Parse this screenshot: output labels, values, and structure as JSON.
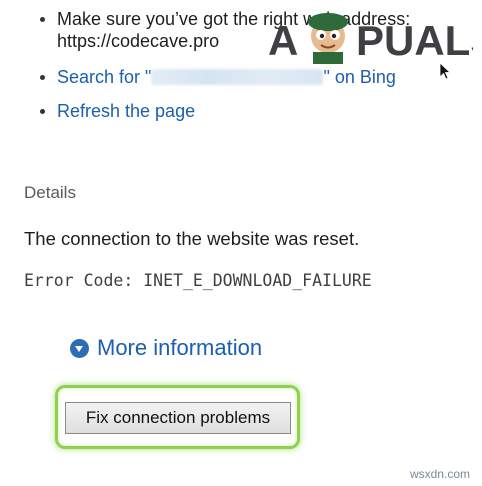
{
  "suggestions": {
    "item1_line1": "Make sure you’ve got the right web address:",
    "item1_line2": "https://codecave.pro",
    "search_prefix": "Search for \"",
    "search_suffix": "\" on Bing",
    "refresh": "Refresh the page"
  },
  "details": {
    "heading": "Details",
    "message": "The connection to the website was reset.",
    "error_code": "Error Code: INET_E_DOWNLOAD_FAILURE"
  },
  "more_info": "More information",
  "fix_button": "Fix connection problems",
  "logo_text": "APPUALS",
  "watermark": "wsxdn.com",
  "icons": {
    "expand": "chevron-down-circle-icon",
    "cursor": "mouse-pointer-icon"
  },
  "colors": {
    "link": "#1b5fb0",
    "highlight": "#8fd14f"
  }
}
